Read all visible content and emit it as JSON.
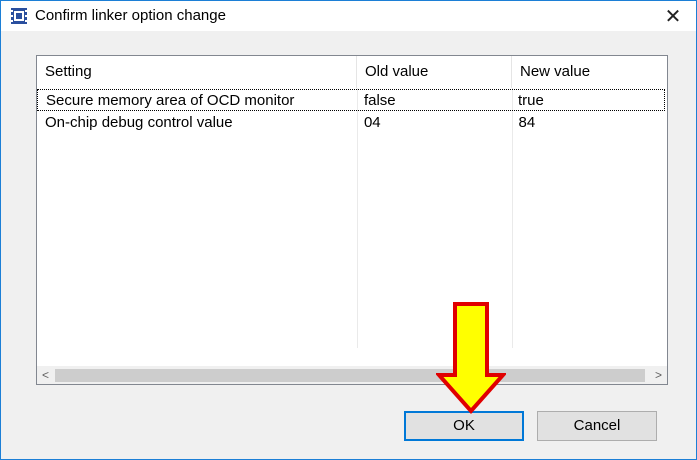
{
  "window": {
    "title": "Confirm linker option change",
    "close_glyph": "✕"
  },
  "table": {
    "columns": [
      "Setting",
      "Old value",
      "New value"
    ],
    "rows": [
      {
        "setting": "Secure memory area of OCD monitor",
        "old": "false",
        "new": "true"
      },
      {
        "setting": "On-chip debug control value",
        "old": "04",
        "new": "84"
      }
    ]
  },
  "scrollbar": {
    "left_arrow": "<",
    "right_arrow": ">"
  },
  "buttons": {
    "ok_label": "OK",
    "cancel_label": "Cancel"
  },
  "colors": {
    "accent": "#0078d7",
    "arrow_fill": "#ffff00",
    "arrow_stroke": "#e00000"
  },
  "icons": {
    "app": "app-chip-icon",
    "close": "close-icon",
    "annotation": "down-arrow-icon"
  }
}
